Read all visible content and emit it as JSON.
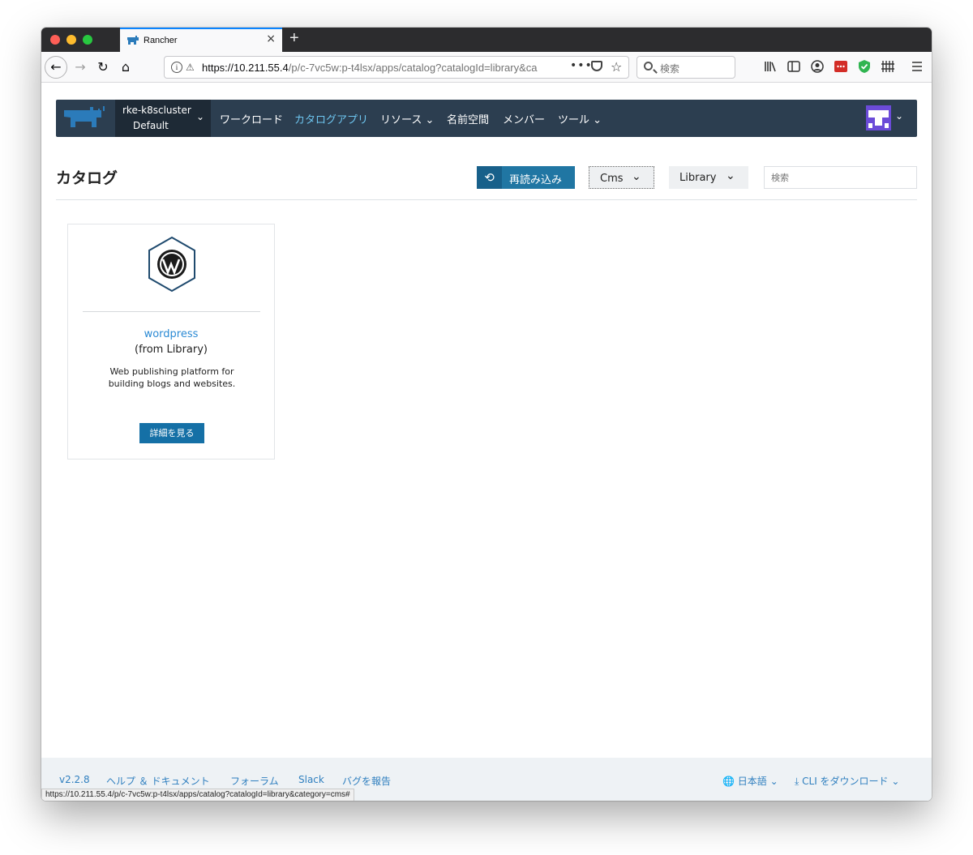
{
  "browser": {
    "tab_title": "Rancher",
    "new_tab_label": "+",
    "close_tab_label": "×",
    "url_host": "https://10.211.55.4",
    "url_path": "/p/c-7vc5w:p-t4lsx/apps/catalog?catalogId=library&ca",
    "search_placeholder": "検索",
    "more_label": "•••",
    "status_url": "https://10.211.55.4/p/c-7vc5w:p-t4lsx/apps/catalog?catalogId=library&category=cms#"
  },
  "header": {
    "cluster_name": "rke-k8scluster",
    "project_name": "Default",
    "nav": {
      "workload": "ワークロード",
      "catalog_apps": "カタログアプリ",
      "resources": "リソース",
      "namespaces": "名前空間",
      "members": "メンバー",
      "tools": "ツール"
    },
    "accent_color": "#2c3e50",
    "active_color": "#6ec6f0"
  },
  "page": {
    "title": "カタログ",
    "reload_label": "再読み込み",
    "category_filter": "Cms",
    "catalog_filter": "Library",
    "search_placeholder": "検索"
  },
  "apps": [
    {
      "name": "wordpress",
      "source": "(from Library)",
      "description": "Web publishing platform for building blogs and websites.",
      "button_label": "詳細を見る",
      "icon": "wordpress-icon"
    }
  ],
  "footer": {
    "version": "v2.2.8",
    "help": "ヘルプ ＆ ドキュメント",
    "forums": "フォーラム",
    "slack": "Slack",
    "report_bug": "バグを報告",
    "language": "日本語",
    "cli_download": "CLI をダウンロード"
  }
}
